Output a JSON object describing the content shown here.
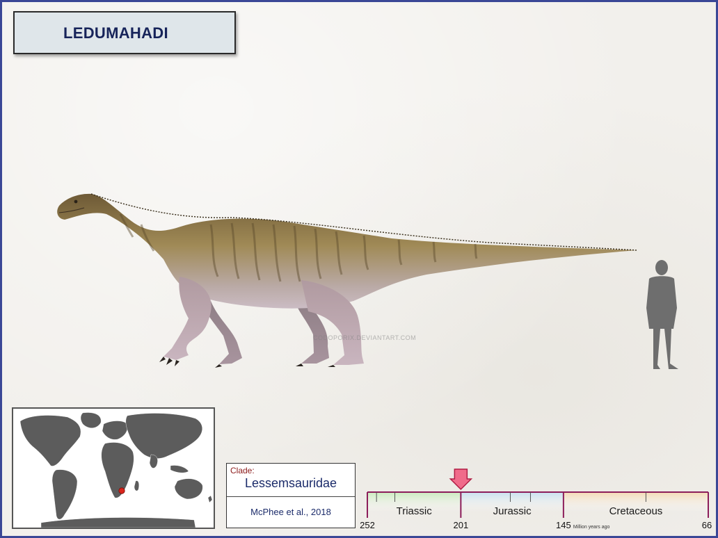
{
  "title": "LEDUMAHADI",
  "clade": {
    "label": "Clade:",
    "value": "Lessemsauridae",
    "citation": "McPhee et al., 2018"
  },
  "timeline": {
    "periods": [
      {
        "name": "Triassic",
        "start": 252,
        "end": 201,
        "color": "#c9ebbd"
      },
      {
        "name": "Jurassic",
        "start": 201,
        "end": 145,
        "color": "#c8e0f0"
      },
      {
        "name": "Cretaceous",
        "start": 145,
        "end": 66,
        "color": "#f4d9b4"
      }
    ],
    "tick_labels": [
      "252",
      "201",
      "145",
      "66"
    ],
    "unit_label": "Million years ago",
    "marker_value": 201,
    "colors": {
      "line": "#8c1d5a",
      "marker": "#f06b8a"
    }
  },
  "map": {
    "marker_region": "southern Africa",
    "marker_color": "#d9251c"
  },
  "watermark": "CODOPORIX.DEVIANTART.COM",
  "colors": {
    "frame": "#3a4796",
    "title_text": "#17245a",
    "clade_label": "#8b1a1a",
    "body_text": "#1b2b6a"
  },
  "icons": [
    "dinosaur-illustration",
    "human-silhouette-icon",
    "world-map",
    "location-marker-icon",
    "down-arrow-icon"
  ]
}
